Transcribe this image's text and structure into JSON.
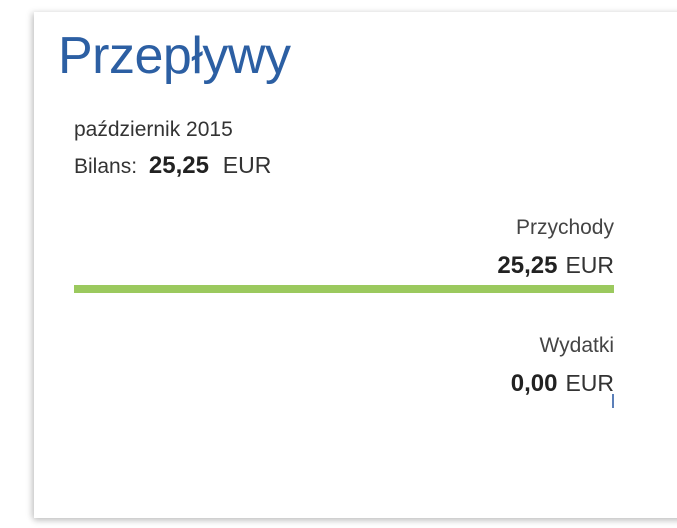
{
  "card": {
    "title": "Przepływy",
    "period": "październik 2015",
    "balance": {
      "label": "Bilans:",
      "value": "25,25",
      "currency": "EUR"
    },
    "income": {
      "label": "Przychody",
      "value": "25,25",
      "currency": "EUR",
      "bar_fraction": 1.0
    },
    "expenses": {
      "label": "Wydatki",
      "value": "0,00",
      "currency": "EUR",
      "bar_fraction": 0.0
    }
  },
  "colors": {
    "title": "#2c5fa3",
    "income_bar": "#9bc95e",
    "expense_bar": "#5b7fb8"
  }
}
